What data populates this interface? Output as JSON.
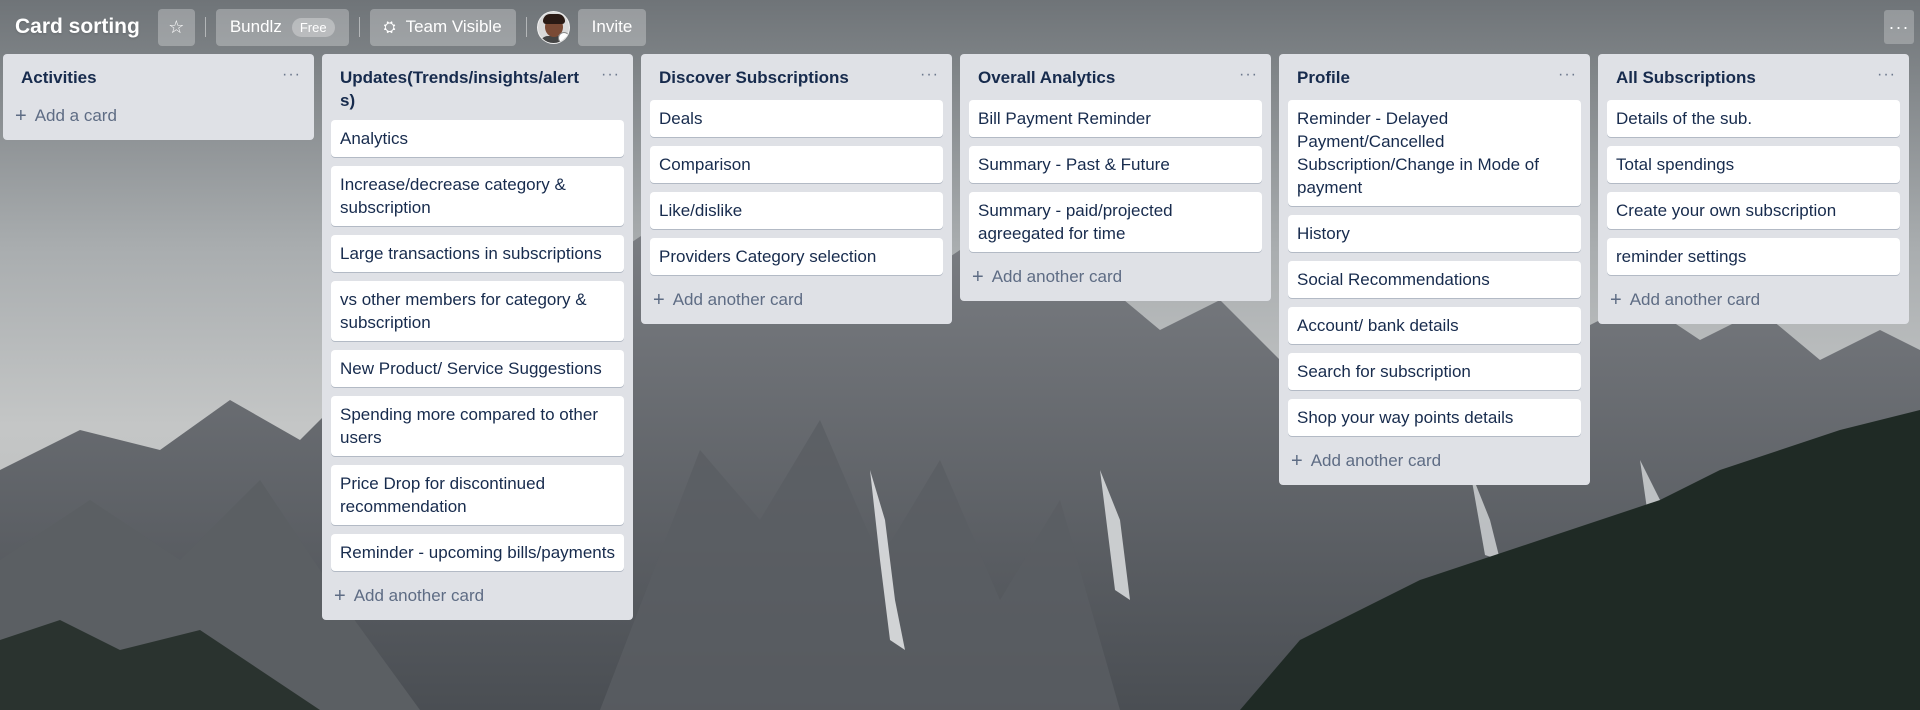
{
  "header": {
    "board_title": "Card sorting",
    "star_icon": "star-icon",
    "workspace": "Bundlz",
    "workspace_badge": "Free",
    "visibility": "Team Visible",
    "invite": "Invite",
    "more": "···"
  },
  "colors": {
    "list_bg": "#dfe1e6",
    "card_bg": "#ffffff",
    "title_text": "#172b4d",
    "muted_text": "#5e6c84"
  },
  "lists": [
    {
      "title": "Activities",
      "cards": [],
      "add_label": "Add a card"
    },
    {
      "title": "Updates(Trends/insights/alerts)",
      "cards": [
        "Analytics",
        "Increase/decrease category & subscription",
        "Large transactions in subscriptions",
        "vs other members for category & subscription",
        "New Product/ Service Suggestions",
        "Spending more compared to other users",
        "Price Drop for discontinued recommendation",
        "Reminder - upcoming bills/payments"
      ],
      "add_label": "Add another card"
    },
    {
      "title": "Discover Subscriptions",
      "cards": [
        "Deals",
        "Comparison",
        "Like/dislike",
        "Providers Category selection"
      ],
      "add_label": "Add another card"
    },
    {
      "title": "Overall Analytics",
      "cards": [
        "Bill Payment Reminder",
        "Summary - Past & Future",
        "Summary - paid/projected agreegated for time"
      ],
      "add_label": "Add another card"
    },
    {
      "title": "Profile",
      "cards": [
        "Reminder - Delayed Payment/Cancelled Subscription/Change in Mode of payment",
        "History",
        "Social Recommendations",
        "Account/ bank details",
        "Search for subscription",
        "Shop your way points details"
      ],
      "add_label": "Add another card"
    },
    {
      "title": "All Subscriptions",
      "cards": [
        "Details of the sub.",
        "Total spendings",
        "Create your own subscription",
        "reminder settings"
      ],
      "add_label": "Add another card"
    }
  ],
  "list_menu": "···",
  "add_icon": "+"
}
